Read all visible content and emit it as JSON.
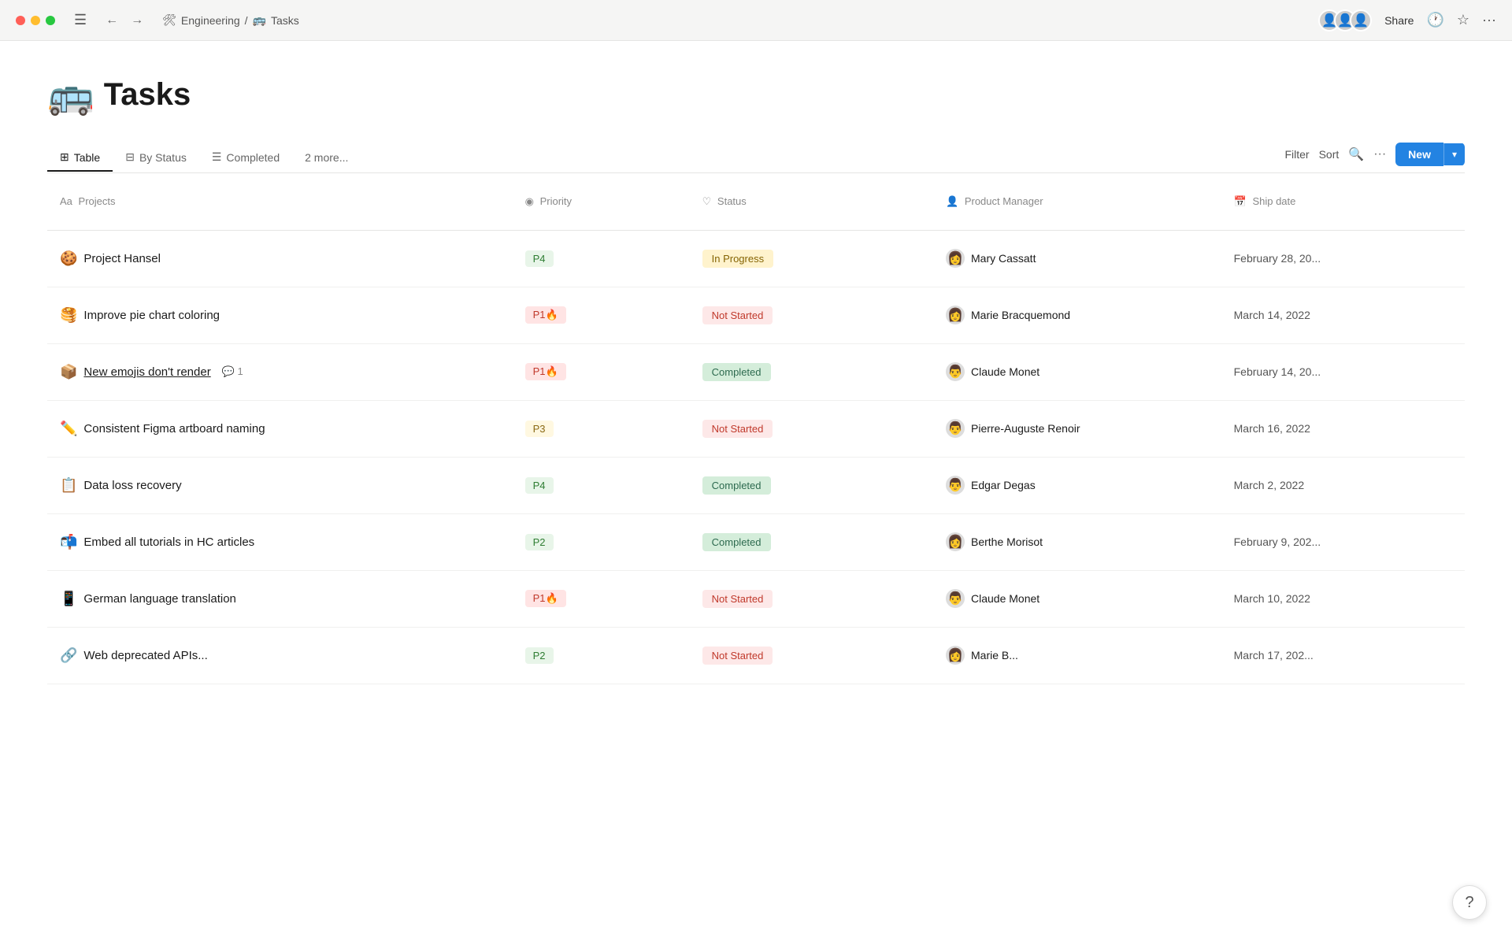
{
  "titlebar": {
    "menu_icon": "☰",
    "back_icon": "←",
    "forward_icon": "→",
    "settings_icon": "🛠",
    "breadcrumb_workspace": "Engineering",
    "breadcrumb_sep": "/",
    "breadcrumb_page_emoji": "🚌",
    "breadcrumb_page": "Tasks",
    "share_label": "Share",
    "history_icon": "🕐",
    "star_icon": "☆",
    "more_icon": "···"
  },
  "page": {
    "emoji": "🚌",
    "title": "Tasks"
  },
  "tabs": [
    {
      "icon": "⊞",
      "label": "Table",
      "active": true
    },
    {
      "icon": "⊟",
      "label": "By Status",
      "active": false
    },
    {
      "icon": "☰",
      "label": "Completed",
      "active": false
    },
    {
      "label": "2 more...",
      "active": false
    }
  ],
  "toolbar": {
    "filter_label": "Filter",
    "sort_label": "Sort",
    "search_icon": "🔍",
    "more_icon": "···",
    "new_label": "New",
    "chevron": "▾"
  },
  "columns": [
    {
      "icon": "Aa",
      "label": "Projects"
    },
    {
      "icon": "◉",
      "label": "Priority"
    },
    {
      "icon": "♡",
      "label": "Status"
    },
    {
      "icon": "👤",
      "label": "Product Manager"
    },
    {
      "icon": "📅",
      "label": "Ship date"
    }
  ],
  "rows": [
    {
      "emoji": "🍪",
      "name": "Project Hansel",
      "underline": false,
      "comment_count": null,
      "priority": "P4",
      "priority_class": "p4",
      "status": "In Progress",
      "status_class": "in-progress",
      "manager_avatar": "👩",
      "manager": "Mary Cassatt",
      "date": "February 28, 20..."
    },
    {
      "emoji": "🥞",
      "name": "Improve pie chart coloring",
      "underline": false,
      "comment_count": null,
      "priority": "P1🔥",
      "priority_class": "p1",
      "status": "Not Started",
      "status_class": "not-started",
      "manager_avatar": "👩",
      "manager": "Marie Bracquemond",
      "date": "March 14, 2022"
    },
    {
      "emoji": "📦",
      "name": "New emojis don't render",
      "underline": true,
      "comment_count": 1,
      "priority": "P1🔥",
      "priority_class": "p1",
      "status": "Completed",
      "status_class": "completed",
      "manager_avatar": "👨",
      "manager": "Claude Monet",
      "date": "February 14, 20..."
    },
    {
      "emoji": "✏️",
      "name": "Consistent Figma artboard naming",
      "underline": false,
      "comment_count": null,
      "priority": "P3",
      "priority_class": "p3",
      "status": "Not Started",
      "status_class": "not-started",
      "manager_avatar": "👨",
      "manager": "Pierre-Auguste Renoir",
      "date": "March 16, 2022"
    },
    {
      "emoji": "📋",
      "name": "Data loss recovery",
      "underline": false,
      "comment_count": null,
      "priority": "P4",
      "priority_class": "p4",
      "status": "Completed",
      "status_class": "completed",
      "manager_avatar": "👨",
      "manager": "Edgar Degas",
      "date": "March 2, 2022"
    },
    {
      "emoji": "📬",
      "name": "Embed all tutorials in HC articles",
      "underline": false,
      "comment_count": null,
      "priority": "P2",
      "priority_class": "p2",
      "status": "Completed",
      "status_class": "completed",
      "manager_avatar": "👩",
      "manager": "Berthe Morisot",
      "date": "February 9, 202..."
    },
    {
      "emoji": "📱",
      "name": "German language translation",
      "underline": false,
      "comment_count": null,
      "priority": "P1🔥",
      "priority_class": "p1",
      "status": "Not Started",
      "status_class": "not-started",
      "manager_avatar": "👨",
      "manager": "Claude Monet",
      "date": "March 10, 2022"
    },
    {
      "emoji": "🔗",
      "name": "Web deprecated APIs...",
      "underline": false,
      "comment_count": null,
      "priority": "P2",
      "priority_class": "p2",
      "status": "Not Started",
      "status_class": "not-started",
      "manager_avatar": "👩",
      "manager": "Marie B...",
      "date": "March 17, 202..."
    }
  ],
  "help_label": "?"
}
